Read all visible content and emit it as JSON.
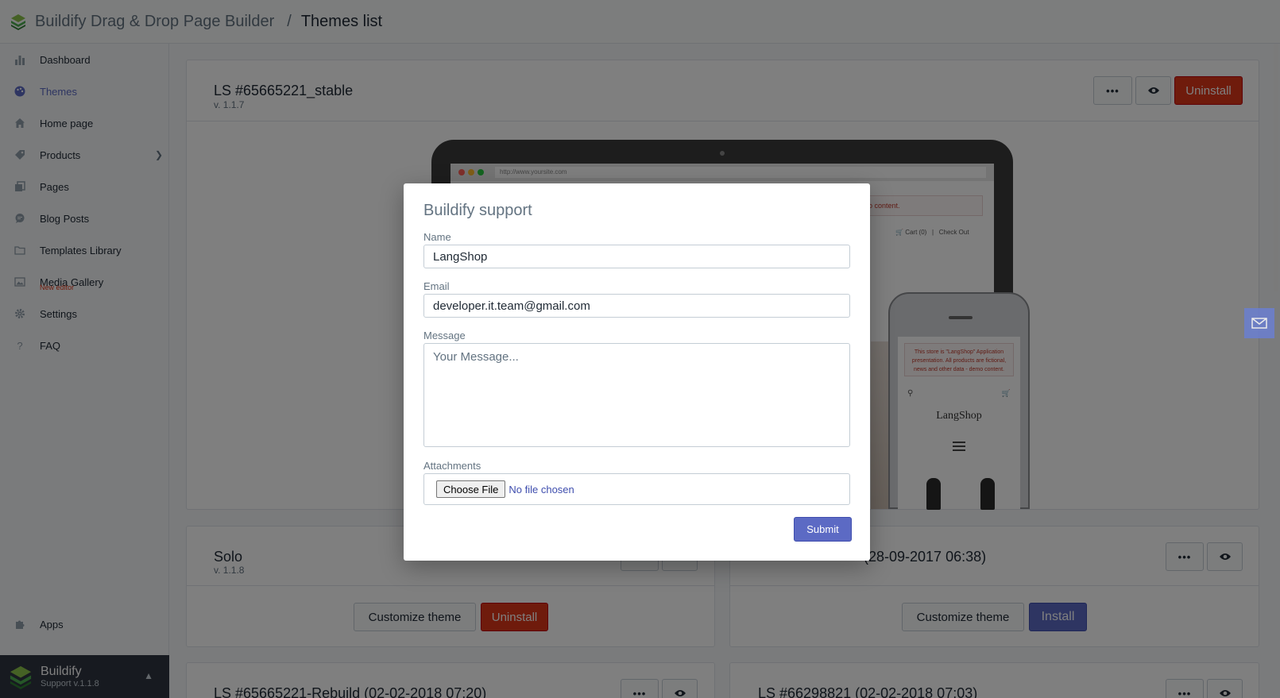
{
  "header": {
    "app_name": "Buildify Drag & Drop Page Builder",
    "separator": "/",
    "page_title": "Themes list"
  },
  "sidebar": {
    "items": [
      {
        "label": "Dashboard",
        "icon": "bar-chart-icon"
      },
      {
        "label": "Themes",
        "icon": "palette-icon",
        "active": true
      },
      {
        "label": "Home page",
        "icon": "home-icon"
      },
      {
        "label": "Products",
        "icon": "tag-icon",
        "has_children": true
      },
      {
        "label": "Pages",
        "icon": "pages-icon"
      },
      {
        "label": "Blog Posts",
        "icon": "chat-icon"
      },
      {
        "label": "Templates Library",
        "icon": "folder-icon"
      },
      {
        "label": "Media Gallery",
        "icon": "image-icon",
        "sub_label": "New editor"
      },
      {
        "label": "Settings",
        "icon": "gear-icon"
      },
      {
        "label": "FAQ",
        "icon": "question-icon"
      }
    ],
    "apps_label": "Apps",
    "footer": {
      "name": "Buildify",
      "version": "Support v.1.1.8"
    }
  },
  "themes": [
    {
      "title": "LS #65665221_stable",
      "version": "v. 1.1.7",
      "action": "Uninstall"
    },
    {
      "title": "Solo",
      "version": "v. 1.1.8",
      "customize": "Customize theme",
      "action": "Uninstall"
    },
    {
      "title": "(28-09-2017 06:38)",
      "customize": "Customize theme",
      "action": "Install"
    },
    {
      "title": "LS #65665221-Rebuild (02-02-2018 07:20)"
    },
    {
      "title": "LS #66298821 (02-02-2018 07:03)"
    }
  ],
  "preview": {
    "url": "http://www.yoursite.com",
    "notice": "no content.",
    "cart": "Cart (0)",
    "checkout": "Check Out",
    "phone_notice": "This store is \"LangShop\" Application presentation. All products are fictional, news and other data - demo content.",
    "phone_brand": "LangShop"
  },
  "modal": {
    "title": "Buildify support",
    "name_label": "Name",
    "name_value": "LangShop",
    "email_label": "Email",
    "email_value": "developer.it.team@gmail.com",
    "message_label": "Message",
    "message_placeholder": "Your Message...",
    "attachments_label": "Attachments",
    "choose_file": "Choose File",
    "no_file": "No file chosen",
    "submit": "Submit"
  },
  "colors": {
    "accent": "#5c6ac4",
    "danger": "#de3618",
    "sidebar_footer": "#2f3541"
  }
}
